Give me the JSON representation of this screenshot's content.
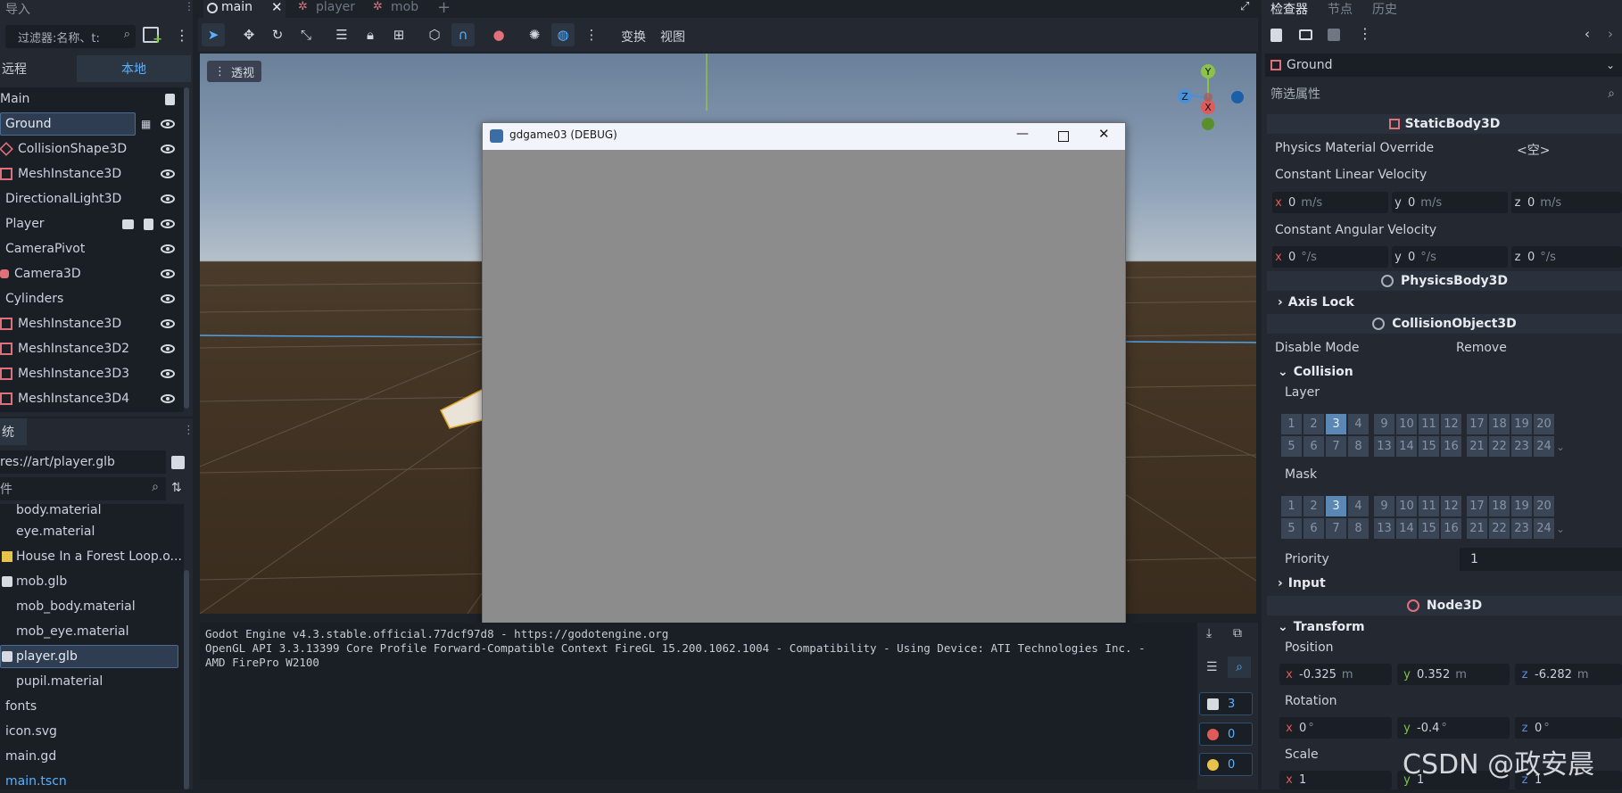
{
  "top_left": {
    "import_label": "导入"
  },
  "scene_dock": {
    "filter_placeholder": "过滤器:名称、t:",
    "tab_remote": "远程",
    "tab_local": "本地",
    "nodes": [
      {
        "label": "Main"
      },
      {
        "label": "Ground"
      },
      {
        "label": "CollisionShape3D"
      },
      {
        "label": "MeshInstance3D"
      },
      {
        "label": "DirectionalLight3D"
      },
      {
        "label": "Player"
      },
      {
        "label": "CameraPivot"
      },
      {
        "label": "Camera3D"
      },
      {
        "label": "Cylinders"
      },
      {
        "label": "MeshInstance3D"
      },
      {
        "label": "MeshInstance3D2"
      },
      {
        "label": "MeshInstance3D3"
      },
      {
        "label": "MeshInstance3D4"
      }
    ]
  },
  "filesystem_dock": {
    "title": "统",
    "path": "res://art/player.glb",
    "filter_placeholder": "件",
    "files": [
      {
        "label": "body.material"
      },
      {
        "label": "eye.material"
      },
      {
        "label": "House In a Forest Loop.o..."
      },
      {
        "label": "mob.glb"
      },
      {
        "label": "mob_body.material"
      },
      {
        "label": "mob_eye.material"
      },
      {
        "label": "player.glb"
      },
      {
        "label": "pupil.material"
      },
      {
        "label": "fonts"
      },
      {
        "label": "icon.svg"
      },
      {
        "label": "main.gd"
      },
      {
        "label": "main.tscn"
      }
    ]
  },
  "scene_tabs": [
    {
      "label": "main"
    },
    {
      "label": "player"
    },
    {
      "label": "mob"
    }
  ],
  "viewport_toolbar": {
    "transform_menu": "变换",
    "view_menu": "视图"
  },
  "viewport": {
    "perspective_label": "透视",
    "gizmo": {
      "y": "Y",
      "x": "X",
      "z": "Z"
    }
  },
  "debug_window": {
    "title": "gdgame03 (DEBUG)"
  },
  "output_log": {
    "lines": [
      "Godot Engine v4.3.stable.official.77dcf97d8 - https://godotengine.org",
      "OpenGL API 3.3.13399 Core Profile Forward-Compatible Context FireGL 15.200.1062.1004 - Compatibility - Using Device: ATI Technologies Inc. -",
      "AMD FirePro W2100"
    ],
    "counters": {
      "messages": "3",
      "errors": "0",
      "warnings": "0"
    }
  },
  "inspector": {
    "tabs": [
      {
        "label": "检查器"
      },
      {
        "label": "节点"
      },
      {
        "label": "历史"
      }
    ],
    "object": "Ground",
    "filter_placeholder": "筛选属性",
    "static_body": "StaticBody3D",
    "physics_material_label": "Physics Material Override",
    "physics_material_value": "<空>",
    "const_linear_label": "Constant Linear Velocity",
    "const_linear": {
      "x": "0",
      "y": "0",
      "z": "0",
      "unit": "m/s"
    },
    "const_angular_label": "Constant Angular Velocity",
    "const_angular": {
      "x": "0",
      "y": "0",
      "z": "0",
      "unit": "°/s"
    },
    "physics_body": "PhysicsBody3D",
    "axis_lock": "Axis Lock",
    "collision_object": "CollisionObject3D",
    "disable_mode_label": "Disable Mode",
    "disable_mode_value": "Remove",
    "collision_group": "Collision",
    "layer_label": "Layer",
    "mask_label": "Mask",
    "layer_active": 3,
    "priority_label": "Priority",
    "priority_value": "1",
    "input_group": "Input",
    "node3d": "Node3D",
    "transform_group": "Transform",
    "position_label": "Position",
    "position": {
      "x": "-0.325",
      "y": "0.352",
      "z": "-6.282",
      "unit": "m"
    },
    "rotation_label": "Rotation",
    "rotation": {
      "x": "0",
      "y": "-0.4",
      "z": "0",
      "unit": "°"
    },
    "scale_label": "Scale",
    "scale": {
      "x": "1",
      "y": "1",
      "z": "1"
    }
  },
  "watermark": "CSDN @政安晨"
}
